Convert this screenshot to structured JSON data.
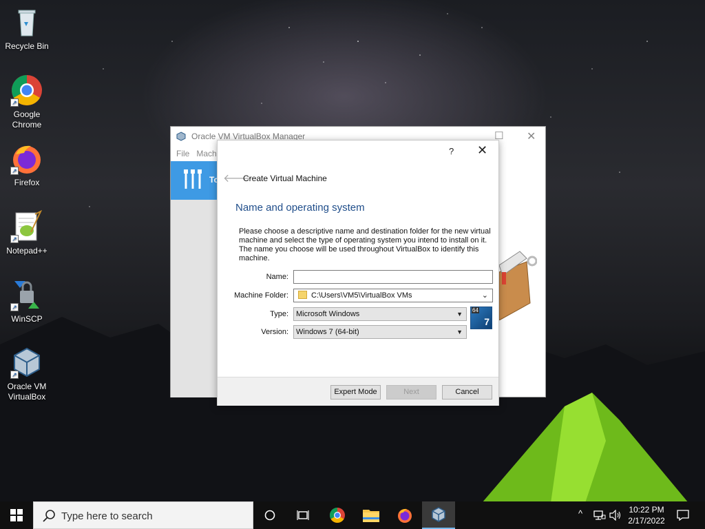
{
  "desktop": {
    "icons": [
      {
        "label": "Recycle Bin"
      },
      {
        "label": "Google\nChrome"
      },
      {
        "label": "Firefox"
      },
      {
        "label": "Notepad++"
      },
      {
        "label": "WinSCP"
      },
      {
        "label": "Oracle VM\nVirtualBox"
      }
    ]
  },
  "manager": {
    "title": "Oracle VM VirtualBox Manager",
    "menu": [
      "File",
      "Mach"
    ],
    "tools_label": "To"
  },
  "dialog": {
    "help_glyph": "?",
    "close_glyph": "✕",
    "back_glyph": "🡐",
    "title": "Create Virtual Machine",
    "heading": "Name and operating system",
    "description": "Please choose a descriptive name and destination folder for the new virtual machine and select the type of operating system you intend to install on it. The name you choose will be used throughout VirtualBox to identify this machine.",
    "name_label": "Name:",
    "name_value": "",
    "folder_label": "Machine Folder:",
    "folder_value": "C:\\Users\\VM5\\VirtualBox VMs",
    "type_label": "Type:",
    "type_value": "Microsoft Windows",
    "version_label": "Version:",
    "version_value": "Windows 7 (64-bit)",
    "os_badge_64": "64",
    "os_badge_7": "7",
    "buttons": {
      "expert": "Expert Mode",
      "next": "Next",
      "cancel": "Cancel"
    }
  },
  "taskbar": {
    "search_placeholder": "Type here to search",
    "time": "10:22 PM",
    "date": "2/17/2022"
  }
}
